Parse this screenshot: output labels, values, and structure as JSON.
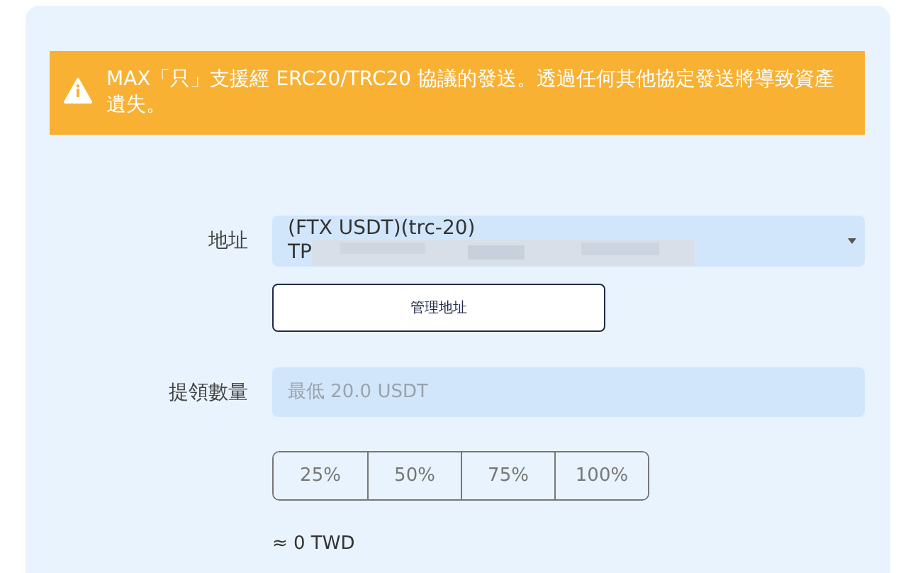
{
  "alert": {
    "text": "MAX「只」支援經 ERC20/TRC20 協議的發送。透過任何其他協定發送將導致資產遺失。"
  },
  "address": {
    "label": "地址",
    "line_1": "(FTX USDT)(trc-20)",
    "line_2": "TP"
  },
  "manage_button": {
    "label": "管理地址"
  },
  "amount": {
    "label": "提領數量",
    "placeholder": "最低 20.0 USDT"
  },
  "percent_buttons": [
    {
      "label": "25%"
    },
    {
      "label": "50%"
    },
    {
      "label": "75%"
    },
    {
      "label": "100%"
    }
  ],
  "estimate": "≈ 0 TWD"
}
